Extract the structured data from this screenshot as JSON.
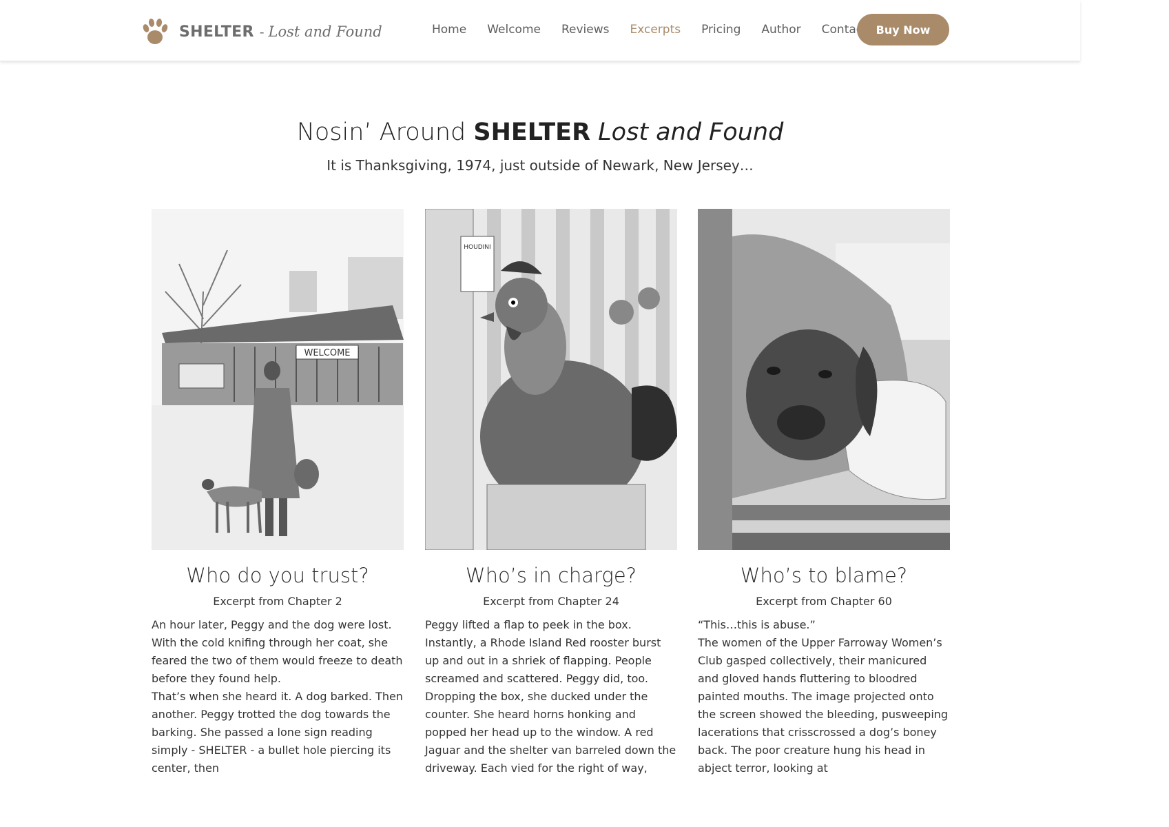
{
  "header": {
    "brand": "SHELTER",
    "brand_dash": "-",
    "brand_script": "Lost and Found",
    "nav": [
      {
        "label": "Home",
        "active": false
      },
      {
        "label": "Welcome",
        "active": false
      },
      {
        "label": "Reviews",
        "active": false
      },
      {
        "label": "Excerpts",
        "active": true
      },
      {
        "label": "Pricing",
        "active": false
      },
      {
        "label": "Author",
        "active": false
      },
      {
        "label": "Contact",
        "active": false
      }
    ],
    "buy_label": "Buy Now"
  },
  "hero": {
    "title_pre": "Nosin’ Around ",
    "title_bold": "SHELTER",
    "title_italic": "Lost and Found",
    "subtitle": "It is Thanksgiving, 1974, just outside of Newark, New Jersey…"
  },
  "excerpts": [
    {
      "title": "Who do you trust?",
      "chapter": "Excerpt from Chapter 2",
      "paragraphs": [
        "An hour later, Peggy and the dog were lost. With the cold knifing through her coat, she feared the two of them would freeze to death before they found help.",
        "That’s when she heard it. A dog barked. Then another. Peggy trotted the dog towards the barking. She passed a lone sign reading simply - SHELTER - a bullet hole piercing its center, then"
      ],
      "sign_text": "WELCOME"
    },
    {
      "title": "Who’s in charge?",
      "chapter": "Excerpt from Chapter 24",
      "paragraphs": [
        "Peggy lifted a flap to peek in the box. Instantly, a Rhode Island Red rooster burst up and out in a shriek of flapping. People screamed and scattered. Peggy did, too. Dropping the box, she ducked under the counter. She heard horns honking and popped her head up to the window. A red Jaguar and the shelter van barreled down the driveway. Each vied for the right of way,"
      ],
      "sign_text": "HOUDINI"
    },
    {
      "title": "Who’s to blame?",
      "chapter": "Excerpt from Chapter 60",
      "paragraphs": [
        "“This…this is abuse.”",
        "The women of the Upper Farroway Women’s Club gasped collectively, their manicured and gloved hands fluttering to bloodred painted mouths. The image projected onto the screen showed the bleeding, pusweeping lacerations that crisscrossed a dog’s boney back. The poor creature hung his head in abject terror, looking at"
      ]
    }
  ],
  "colors": {
    "accent": "#a98b6a",
    "text": "#333333",
    "nav": "#5e5e5e"
  }
}
